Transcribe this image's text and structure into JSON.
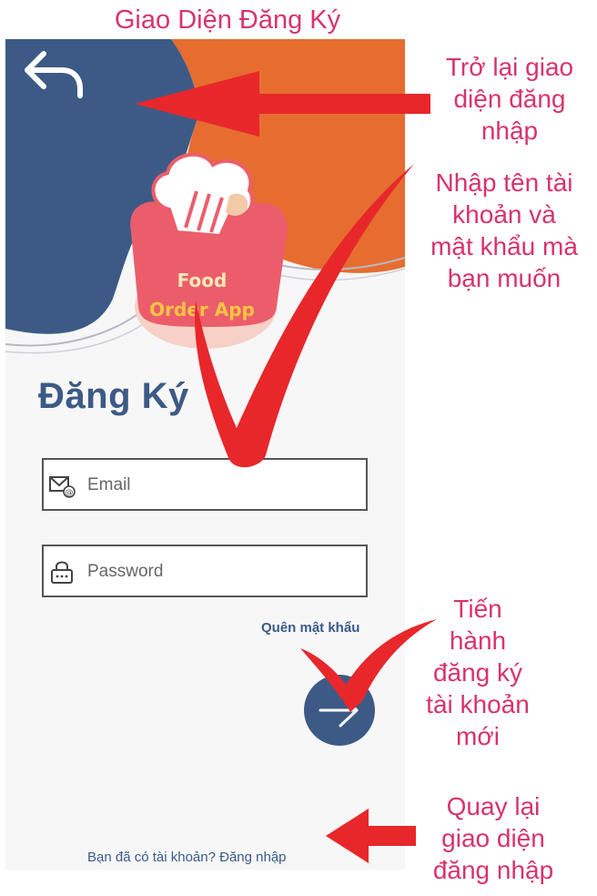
{
  "page_title": "Giao Diện Đăng Ký",
  "screen": {
    "heading": "Đăng Ký",
    "logo": {
      "line1": "Food",
      "line2": "Order App"
    },
    "email_field": {
      "placeholder": "Email",
      "value": ""
    },
    "password_field": {
      "placeholder": "Password",
      "value": ""
    },
    "forgot_link": "Quên mật khẩu",
    "login_link": "Bạn đã có tài khoản? Đăng nhập"
  },
  "annotations": {
    "back": [
      "Trở lại giao",
      "diện đăng",
      "nhập"
    ],
    "input": [
      "Nhập tên tài",
      "khoản và",
      "mật khẩu mà",
      "bạn muốn"
    ],
    "submit": [
      "Tiến",
      "hành",
      "đăng ký",
      "tài khoản",
      "mới"
    ],
    "login": [
      "Quay lại",
      "giao diện",
      "đăng nhập"
    ]
  },
  "colors": {
    "navy": "#3d5a86",
    "orange": "#e66d2f",
    "annotation": "#d8336c",
    "arrow": "#e8272b"
  },
  "icons": [
    "back-arrow-icon",
    "chef-hat-icon",
    "mail-icon",
    "lock-icon",
    "arrow-right-icon"
  ]
}
